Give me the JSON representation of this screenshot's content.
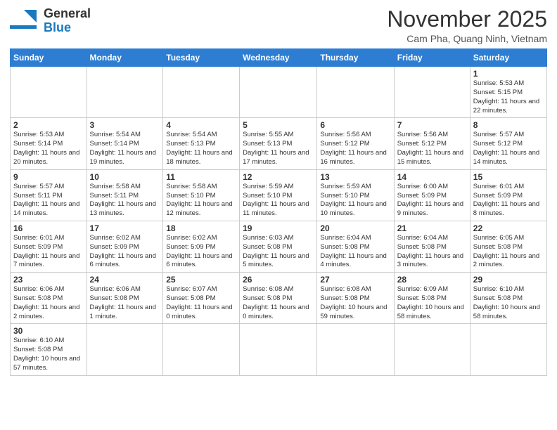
{
  "header": {
    "logo_general": "General",
    "logo_blue": "Blue",
    "month": "November 2025",
    "location": "Cam Pha, Quang Ninh, Vietnam"
  },
  "days_of_week": [
    "Sunday",
    "Monday",
    "Tuesday",
    "Wednesday",
    "Thursday",
    "Friday",
    "Saturday"
  ],
  "weeks": [
    [
      {
        "day": "",
        "info": ""
      },
      {
        "day": "",
        "info": ""
      },
      {
        "day": "",
        "info": ""
      },
      {
        "day": "",
        "info": ""
      },
      {
        "day": "",
        "info": ""
      },
      {
        "day": "",
        "info": ""
      },
      {
        "day": "1",
        "info": "Sunrise: 5:53 AM\nSunset: 5:15 PM\nDaylight: 11 hours and 22 minutes."
      }
    ],
    [
      {
        "day": "2",
        "info": "Sunrise: 5:53 AM\nSunset: 5:14 PM\nDaylight: 11 hours and 20 minutes."
      },
      {
        "day": "3",
        "info": "Sunrise: 5:54 AM\nSunset: 5:14 PM\nDaylight: 11 hours and 19 minutes."
      },
      {
        "day": "4",
        "info": "Sunrise: 5:54 AM\nSunset: 5:13 PM\nDaylight: 11 hours and 18 minutes."
      },
      {
        "day": "5",
        "info": "Sunrise: 5:55 AM\nSunset: 5:13 PM\nDaylight: 11 hours and 17 minutes."
      },
      {
        "day": "6",
        "info": "Sunrise: 5:56 AM\nSunset: 5:12 PM\nDaylight: 11 hours and 16 minutes."
      },
      {
        "day": "7",
        "info": "Sunrise: 5:56 AM\nSunset: 5:12 PM\nDaylight: 11 hours and 15 minutes."
      },
      {
        "day": "8",
        "info": "Sunrise: 5:57 AM\nSunset: 5:12 PM\nDaylight: 11 hours and 14 minutes."
      }
    ],
    [
      {
        "day": "9",
        "info": "Sunrise: 5:57 AM\nSunset: 5:11 PM\nDaylight: 11 hours and 14 minutes."
      },
      {
        "day": "10",
        "info": "Sunrise: 5:58 AM\nSunset: 5:11 PM\nDaylight: 11 hours and 13 minutes."
      },
      {
        "day": "11",
        "info": "Sunrise: 5:58 AM\nSunset: 5:10 PM\nDaylight: 11 hours and 12 minutes."
      },
      {
        "day": "12",
        "info": "Sunrise: 5:59 AM\nSunset: 5:10 PM\nDaylight: 11 hours and 11 minutes."
      },
      {
        "day": "13",
        "info": "Sunrise: 5:59 AM\nSunset: 5:10 PM\nDaylight: 11 hours and 10 minutes."
      },
      {
        "day": "14",
        "info": "Sunrise: 6:00 AM\nSunset: 5:09 PM\nDaylight: 11 hours and 9 minutes."
      },
      {
        "day": "15",
        "info": "Sunrise: 6:01 AM\nSunset: 5:09 PM\nDaylight: 11 hours and 8 minutes."
      }
    ],
    [
      {
        "day": "16",
        "info": "Sunrise: 6:01 AM\nSunset: 5:09 PM\nDaylight: 11 hours and 7 minutes."
      },
      {
        "day": "17",
        "info": "Sunrise: 6:02 AM\nSunset: 5:09 PM\nDaylight: 11 hours and 6 minutes."
      },
      {
        "day": "18",
        "info": "Sunrise: 6:02 AM\nSunset: 5:09 PM\nDaylight: 11 hours and 6 minutes."
      },
      {
        "day": "19",
        "info": "Sunrise: 6:03 AM\nSunset: 5:08 PM\nDaylight: 11 hours and 5 minutes."
      },
      {
        "day": "20",
        "info": "Sunrise: 6:04 AM\nSunset: 5:08 PM\nDaylight: 11 hours and 4 minutes."
      },
      {
        "day": "21",
        "info": "Sunrise: 6:04 AM\nSunset: 5:08 PM\nDaylight: 11 hours and 3 minutes."
      },
      {
        "day": "22",
        "info": "Sunrise: 6:05 AM\nSunset: 5:08 PM\nDaylight: 11 hours and 2 minutes."
      }
    ],
    [
      {
        "day": "23",
        "info": "Sunrise: 6:06 AM\nSunset: 5:08 PM\nDaylight: 11 hours and 2 minutes."
      },
      {
        "day": "24",
        "info": "Sunrise: 6:06 AM\nSunset: 5:08 PM\nDaylight: 11 hours and 1 minute."
      },
      {
        "day": "25",
        "info": "Sunrise: 6:07 AM\nSunset: 5:08 PM\nDaylight: 11 hours and 0 minutes."
      },
      {
        "day": "26",
        "info": "Sunrise: 6:08 AM\nSunset: 5:08 PM\nDaylight: 11 hours and 0 minutes."
      },
      {
        "day": "27",
        "info": "Sunrise: 6:08 AM\nSunset: 5:08 PM\nDaylight: 10 hours and 59 minutes."
      },
      {
        "day": "28",
        "info": "Sunrise: 6:09 AM\nSunset: 5:08 PM\nDaylight: 10 hours and 58 minutes."
      },
      {
        "day": "29",
        "info": "Sunrise: 6:10 AM\nSunset: 5:08 PM\nDaylight: 10 hours and 58 minutes."
      }
    ],
    [
      {
        "day": "30",
        "info": "Sunrise: 6:10 AM\nSunset: 5:08 PM\nDaylight: 10 hours and 57 minutes."
      },
      {
        "day": "",
        "info": ""
      },
      {
        "day": "",
        "info": ""
      },
      {
        "day": "",
        "info": ""
      },
      {
        "day": "",
        "info": ""
      },
      {
        "day": "",
        "info": ""
      },
      {
        "day": "",
        "info": ""
      }
    ]
  ]
}
